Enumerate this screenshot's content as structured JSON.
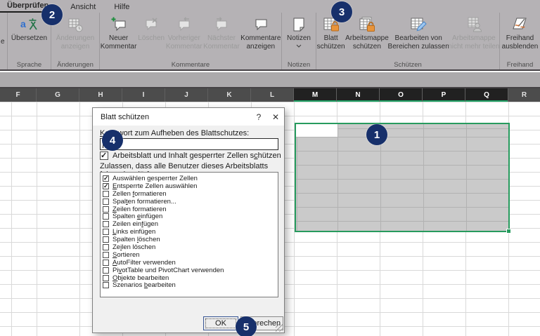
{
  "colors": {
    "excel_green": "#279b5e",
    "header_selected_underline": "#21a366",
    "annotation_navy": "#17306b",
    "lock_orange": "#e8943a",
    "ribbon_gray": "#b5b2b5"
  },
  "ribbon": {
    "tabs": [
      {
        "label": "Überprüfen",
        "active": true
      },
      {
        "label": "Ansicht",
        "active": false
      },
      {
        "label": "Hilfe",
        "active": false
      }
    ],
    "partial_fragment": "e",
    "groups": [
      {
        "label": "Sprache",
        "buttons": [
          {
            "line1": "Übersetzen",
            "line2": "",
            "enabled": true,
            "icon": "translate"
          }
        ]
      },
      {
        "label": "Änderungen",
        "buttons": [
          {
            "line1": "Änderungen",
            "line2": "anzeigen",
            "enabled": false,
            "icon": "show-changes"
          }
        ]
      },
      {
        "label": "Kommentare",
        "buttons": [
          {
            "line1": "Neuer",
            "line2": "Kommentar",
            "enabled": true,
            "icon": "new-comment"
          },
          {
            "line1": "Löschen",
            "line2": "",
            "enabled": false,
            "icon": "delete-comment"
          },
          {
            "line1": "Vorheriger",
            "line2": "Kommentar",
            "enabled": false,
            "icon": "previous-comment"
          },
          {
            "line1": "Nächster",
            "line2": "Kommentar",
            "enabled": false,
            "icon": "next-comment"
          },
          {
            "line1": "Kommentare",
            "line2": "anzeigen",
            "enabled": true,
            "icon": "show-comments"
          }
        ]
      },
      {
        "label": "Notizen",
        "buttons": [
          {
            "line1": "Notizen",
            "line2": "",
            "enabled": true,
            "icon": "notes",
            "dropdown": true
          }
        ]
      },
      {
        "label": "Schützen",
        "buttons": [
          {
            "line1": "Blatt",
            "line2": "schützen",
            "enabled": true,
            "icon": "protect-sheet"
          },
          {
            "line1": "Arbeitsmappe",
            "line2": "schützen",
            "enabled": true,
            "icon": "protect-workbook"
          },
          {
            "line1": "Bearbeiten von",
            "line2": "Bereichen zulassen",
            "enabled": true,
            "icon": "allow-edit-ranges"
          },
          {
            "line1": "Arbeitsmappe",
            "line2": "nicht mehr teilen",
            "enabled": false,
            "icon": "unshare-workbook"
          }
        ]
      },
      {
        "label": "Freihand",
        "buttons": [
          {
            "line1": "Freihand",
            "line2": "ausblenden",
            "enabled": true,
            "icon": "hide-ink"
          }
        ]
      }
    ]
  },
  "sheet": {
    "columns": [
      {
        "label": "F",
        "selected": false
      },
      {
        "label": "G",
        "selected": false
      },
      {
        "label": "H",
        "selected": false
      },
      {
        "label": "I",
        "selected": false
      },
      {
        "label": "J",
        "selected": false
      },
      {
        "label": "K",
        "selected": false
      },
      {
        "label": "L",
        "selected": false
      },
      {
        "label": "M",
        "selected": true
      },
      {
        "label": "N",
        "selected": true
      },
      {
        "label": "O",
        "selected": true
      },
      {
        "label": "P",
        "selected": true
      },
      {
        "label": "Q",
        "selected": true
      },
      {
        "label": "R",
        "selected": false
      }
    ]
  },
  "dialog": {
    "title": "Blatt schützen",
    "help_label": "?",
    "close_label": "✕",
    "password_label_html": "<u>K</u>ennwort zum Aufheben des Blattschutzes:",
    "password_value": "",
    "protect_checkbox": {
      "html": "Arbeitsblatt und Inhalt gesperrter Zellen s<u>c</u>hützen",
      "checked": true
    },
    "allow_label": "Zulassen, dass alle Benutzer dieses Arbeitsblatts folgendes dürfen:",
    "options": [
      {
        "html": "Auswählen <u>g</u>esperrter Zellen",
        "checked": true
      },
      {
        "html": "<u>E</u>ntsperrte Zellen auswählen",
        "checked": true
      },
      {
        "html": "Zellen <u>f</u>ormatieren",
        "checked": false
      },
      {
        "html": "Spal<u>t</u>en formatieren...",
        "checked": false
      },
      {
        "html": "<u>Z</u>eilen formatieren",
        "checked": false
      },
      {
        "html": "Spalten <u>e</u>infügen",
        "checked": false
      },
      {
        "html": "Zeilen ein<u>f</u>ügen",
        "checked": false
      },
      {
        "html": "<u>L</u>inks einfügen",
        "checked": false
      },
      {
        "html": "Spalten <u>l</u>öschen",
        "checked": false
      },
      {
        "html": "Ze<u>i</u>len löschen",
        "checked": false
      },
      {
        "html": "<u>S</u>ortieren",
        "checked": false
      },
      {
        "html": "<u>A</u>utoFilter verwenden",
        "checked": false
      },
      {
        "html": "Pi<u>v</u>otTable und PivotChart verwenden",
        "checked": false
      },
      {
        "html": "<u>O</u>bjekte bearbeiten",
        "checked": false
      },
      {
        "html": "Szenarios <u>b</u>earbeiten",
        "checked": false
      }
    ],
    "ok_label": "OK",
    "cancel_label": "Abbrechen"
  },
  "annotations": [
    {
      "number": "1"
    },
    {
      "number": "2"
    },
    {
      "number": "3"
    },
    {
      "number": "4"
    },
    {
      "number": "5"
    }
  ]
}
